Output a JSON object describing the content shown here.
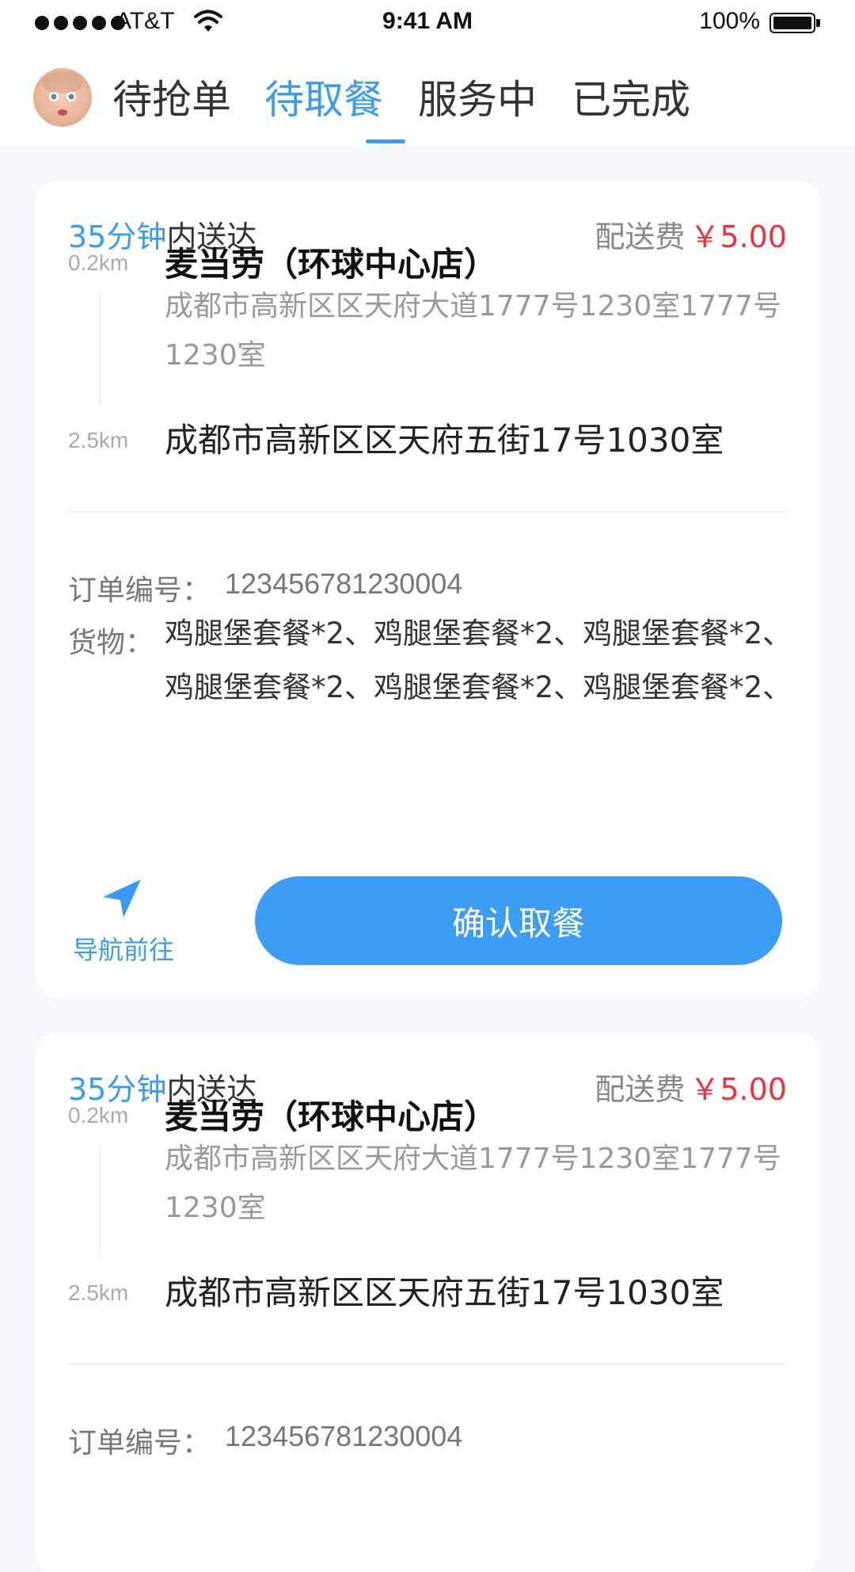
{
  "status_bar": {
    "carrier": "AT&T",
    "time": "9:41 AM",
    "battery": "100%"
  },
  "tabs": [
    {
      "label": "待抢单"
    },
    {
      "label": "待取餐"
    },
    {
      "label": "服务中"
    },
    {
      "label": "已完成"
    }
  ],
  "active_tab": "待取餐",
  "orders": [
    {
      "eta_highlight": "35分钟",
      "eta_suffix": "内送达",
      "fee_label": "配送费",
      "fee_amount": "￥5.00",
      "pickup_distance": "0.2km",
      "shop_name": "麦当劳（环球中心店）",
      "shop_address": "成都市高新区区天府大道1777号1230室1777号1230室",
      "dropoff_distance": "2.5km",
      "dropoff_address": "成都市高新区区天府五街17号1030室",
      "order_no_label": "订单编号：",
      "order_no": "123456781230004",
      "goods_label": "货物：",
      "goods": "鸡腿堡套餐*2、鸡腿堡套餐*2、鸡腿堡套餐*2、鸡腿堡套餐*2、鸡腿堡套餐*2、鸡腿堡套餐*2、",
      "navigate_label": "导航前往",
      "confirm_label": "确认取餐"
    },
    {
      "eta_highlight": "35分钟",
      "eta_suffix": "内送达",
      "fee_label": "配送费",
      "fee_amount": "￥5.00",
      "pickup_distance": "0.2km",
      "shop_name": "麦当劳（环球中心店）",
      "shop_address": "成都市高新区区天府大道1777号1230室1777号1230室",
      "dropoff_distance": "2.5km",
      "dropoff_address": "成都市高新区区天府五街17号1030室",
      "order_no_label": "订单编号：",
      "order_no": "123456781230004"
    }
  ],
  "colors": {
    "accent": "#3a9bf2",
    "price": "#f0313e",
    "background": "#f5f7fb"
  },
  "icons": {
    "navigate": "navigation-arrow-icon",
    "wifi": "wifi-icon",
    "battery": "battery-icon"
  }
}
